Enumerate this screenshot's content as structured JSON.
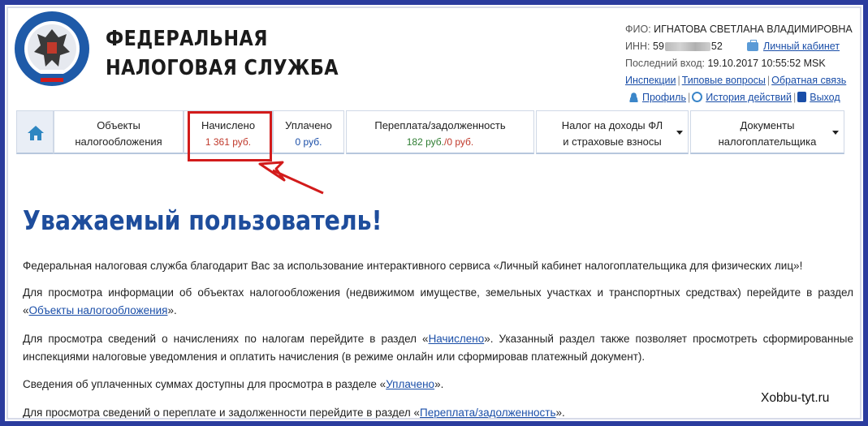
{
  "header": {
    "brand_line1": "ФЕДЕРАЛЬНАЯ",
    "brand_line2": "НАЛОГОВАЯ СЛУЖБА",
    "logo_icon": "fns-emblem-icon"
  },
  "user": {
    "fio_label": "ФИО:",
    "fio_value": "ИГНАТОВА СВЕТЛАНА ВЛАДИМИРОВНА",
    "inn_label": "ИНН:",
    "inn_prefix": "59",
    "inn_suffix": "52",
    "cabinet_link": "Личный кабинет",
    "last_login_label": "Последний вход:",
    "last_login_value": "19.10.2017 10:55:52 MSK"
  },
  "top_links": {
    "inspections": "Инспекции",
    "faq": "Типовые вопросы",
    "feedback": "Обратная связь",
    "profile": "Профиль",
    "history": "История действий",
    "logout": "Выход"
  },
  "nav": {
    "home_icon": "home-icon",
    "objects_line1": "Объекты",
    "objects_line2": "налогообложения",
    "accrued_label": "Начислено",
    "accrued_amount": "1 361 руб.",
    "paid_label": "Уплачено",
    "paid_amount": "0 руб.",
    "overpay_label": "Переплата/задолженность",
    "overpay_amount_a": "182 руб.",
    "overpay_amount_b": "/0 руб.",
    "ndfl_line1": "Налог на доходы ФЛ",
    "ndfl_line2": "и страховые взносы",
    "docs_line1": "Документы",
    "docs_line2": "налогоплательщика"
  },
  "main": {
    "greeting": "Уважаемый пользователь!",
    "p1": "Федеральная налоговая служба благодарит Вас за использование интерактивного сервиса «Личный кабинет налогоплательщика для физических лиц»!",
    "p2_a": "Для просмотра информации об объектах налогообложения (недвижимом имуществе, земельных участках и транспортных средствах) перейдите в раздел «",
    "p2_link": "Объекты налогообложения",
    "p2_b": "».",
    "p3_a": "Для просмотра сведений о начислениях по налогам перейдите в раздел «",
    "p3_link": "Начислено",
    "p3_b": "». Указанный раздел также позволяет просмотреть сформированные инспекциями налоговые уведомления и оплатить начисления (в режиме онлайн или сформировав платежный документ).",
    "p4_a": "Сведения об уплаченных суммах доступны для просмотра в разделе «",
    "p4_link": "Уплачено",
    "p4_b": "».",
    "p5_a": "Для просмотра сведений о переплате и задолженности перейдите в раздел «",
    "p5_link": "Переплата/задолженность",
    "p5_b": "»."
  },
  "watermark": "Xobbu-tyt.ru",
  "colors": {
    "frame": "#2b3c9e",
    "heading": "#1e4d9c",
    "link": "#1a4ea8",
    "highlight": "#d21b1b",
    "amount_red": "#c0392b",
    "amount_green": "#2e7d32"
  }
}
